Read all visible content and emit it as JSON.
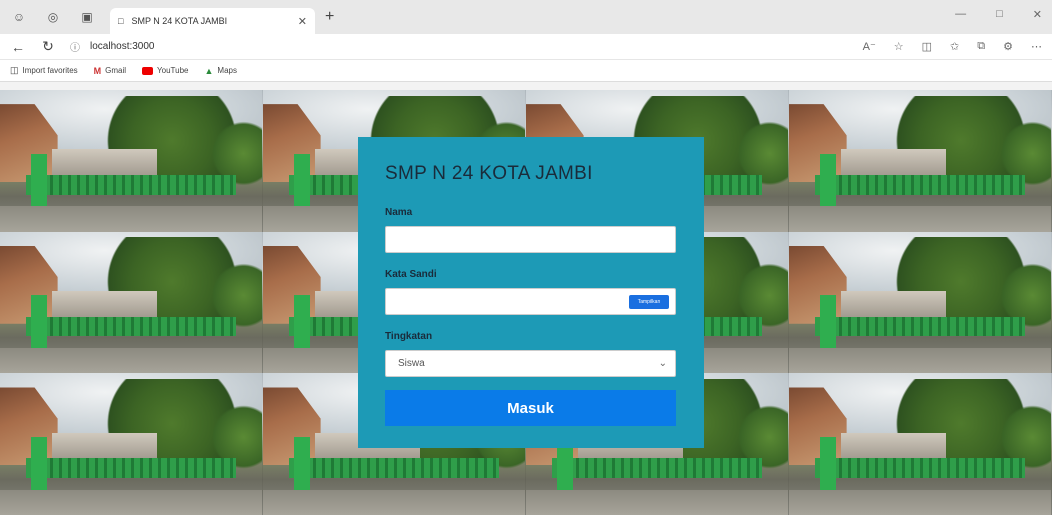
{
  "browser": {
    "tab_title": "SMP N 24 KOTA JAMBI",
    "url": "localhost:3000",
    "favorites": [
      {
        "label": "Import favorites",
        "icon": "folder-icon"
      },
      {
        "label": "Gmail",
        "icon": "gmail-icon"
      },
      {
        "label": "YouTube",
        "icon": "youtube-icon"
      },
      {
        "label": "Maps",
        "icon": "maps-icon"
      }
    ]
  },
  "login": {
    "title": "SMP N 24 KOTA JAMBI",
    "name_label": "Nama",
    "name_value": "",
    "password_label": "Kata Sandi",
    "password_value": "",
    "show_password_label": "Tampilkan",
    "level_label": "Tingkatan",
    "level_selected": "Siswa",
    "submit_label": "Masuk"
  },
  "colors": {
    "card_bg": "#1d9ab6",
    "button_bg": "#0a7be8"
  }
}
